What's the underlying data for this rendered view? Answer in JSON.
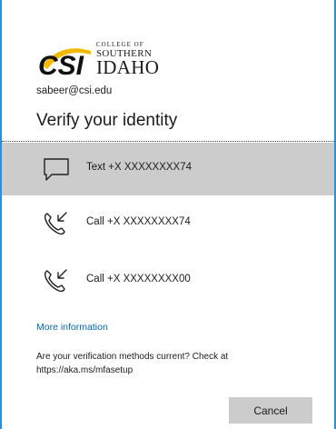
{
  "logo": {
    "mark_text": "CSI",
    "line1": "COLLEGE OF",
    "line2": "SOUTHERN",
    "line3": "IDAHO"
  },
  "account": {
    "email": "sabeer@csi.edu"
  },
  "heading": "Verify your identity",
  "options": [
    {
      "icon": "text-message-icon",
      "label": "Text +X XXXXXXXX74",
      "selected": true
    },
    {
      "icon": "phone-call-icon",
      "label": "Call +X XXXXXXXX74",
      "selected": false
    },
    {
      "icon": "phone-call-icon",
      "label": "Call +X XXXXXXXX00",
      "selected": false
    }
  ],
  "more_info_label": "More information",
  "notice": "Are your verification methods current? Check at https://aka.ms/mfasetup",
  "cancel_label": "Cancel",
  "colors": {
    "frame_border": "#2d8fd6",
    "selected_bg": "#cccccc",
    "link": "#0067b8",
    "logo_yellow": "#f5b800"
  }
}
